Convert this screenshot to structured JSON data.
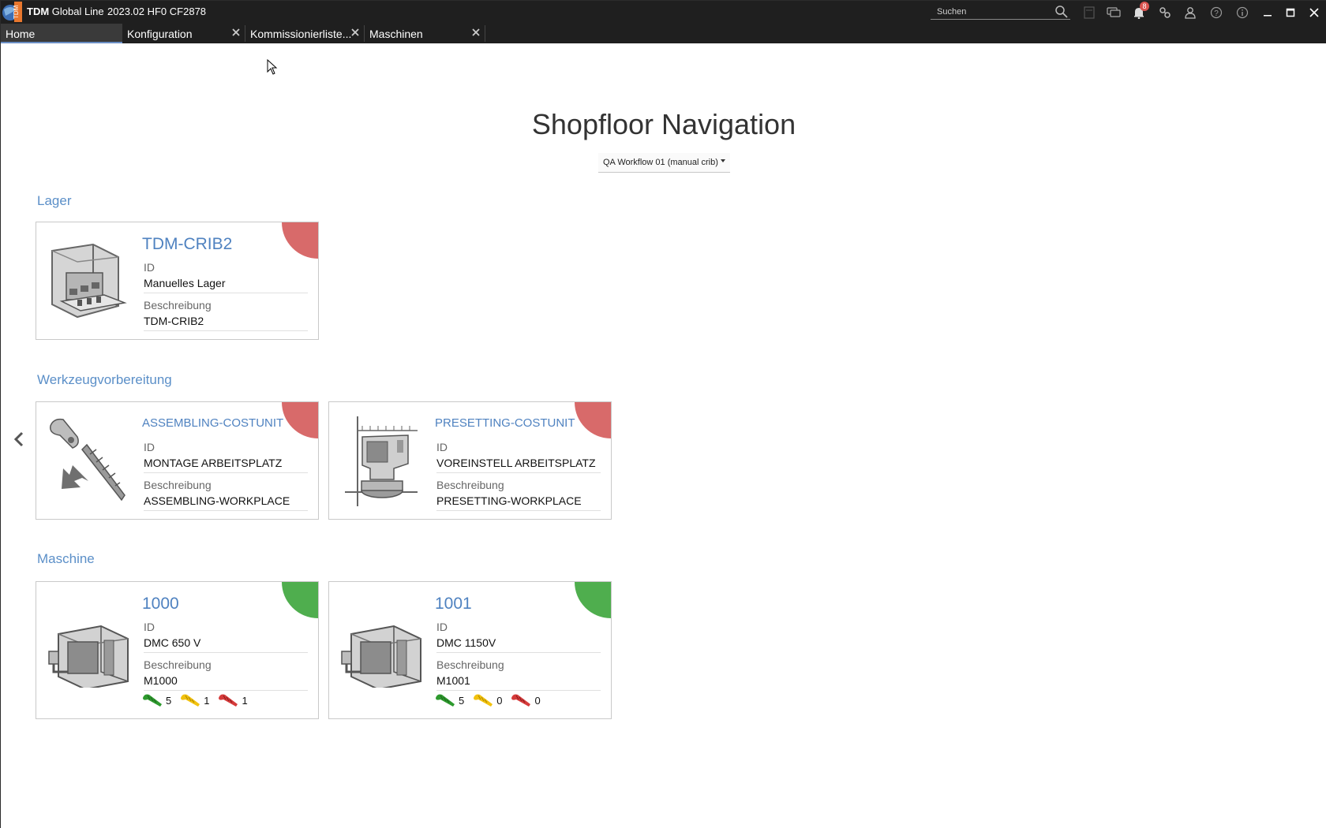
{
  "app": {
    "name_bold": "TDM",
    "name_rest": " Global Line",
    "version": "2023.02 HF0 CF2878",
    "logo_text": "TDM"
  },
  "search": {
    "placeholder": "Suchen"
  },
  "notifications": {
    "count": "8"
  },
  "tabs": [
    {
      "label": "Home",
      "active": true
    },
    {
      "label": "Konfiguration"
    },
    {
      "label": "Kommissionierliste..."
    },
    {
      "label": "Maschinen"
    }
  ],
  "page": {
    "title": "Shopfloor Navigation",
    "workflow": "QA Workflow 01 (manual crib)"
  },
  "sections": {
    "lager": {
      "title": "Lager",
      "cards": [
        {
          "name": "TDM-CRIB2",
          "id_label": "ID",
          "id": "Manuelles Lager",
          "desc_label": "Beschreibung",
          "desc": "TDM-CRIB2",
          "status_color": "#d86a6a"
        }
      ]
    },
    "werkzeug": {
      "title": "Werkzeugvorbereitung",
      "cards": [
        {
          "name": "ASSEMBLING-COSTUNIT",
          "id_label": "ID",
          "id": "MONTAGE ARBEITSPLATZ",
          "desc_label": "Beschreibung",
          "desc": "ASSEMBLING-WORKPLACE",
          "status_color": "#d86a6a"
        },
        {
          "name": "PRESETTING-COSTUNIT",
          "id_label": "ID",
          "id": "VOREINSTELL ARBEITSPLATZ",
          "desc_label": "Beschreibung",
          "desc": "PRESETTING-WORKPLACE",
          "status_color": "#d86a6a"
        }
      ]
    },
    "maschine": {
      "title": "Maschine",
      "cards": [
        {
          "name": "1000",
          "id_label": "ID",
          "id": "DMC 650 V",
          "desc_label": "Beschreibung",
          "desc": "M1000",
          "status_color": "#4fae4e",
          "counts": {
            "green": "5",
            "yellow": "1",
            "red": "1"
          }
        },
        {
          "name": "1001",
          "id_label": "ID",
          "id": "DMC 1150V",
          "desc_label": "Beschreibung",
          "desc": "M1001",
          "status_color": "#4fae4e",
          "counts": {
            "green": "5",
            "yellow": "0",
            "red": "0"
          }
        }
      ]
    }
  },
  "colors": {
    "accent": "#5b8fc8",
    "titlebar": "#1f1f1f",
    "status_red": "#d86a6a",
    "status_green": "#4fae4e",
    "tool_green": "#2e9a2e",
    "tool_yellow": "#f2c20f",
    "tool_red": "#d63b3b"
  }
}
